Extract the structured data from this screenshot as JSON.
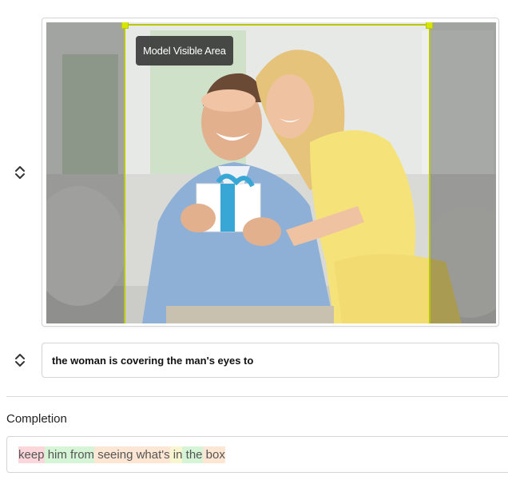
{
  "image_block": {
    "area_label": "Model Visible Area",
    "frame_color": "#b8c700",
    "icons": {
      "reorder": "chevron-up-down-icon"
    }
  },
  "prompt_block": {
    "text": "the woman is covering the man's eyes to",
    "icons": {
      "reorder": "chevron-up-down-icon"
    }
  },
  "completion": {
    "title": "Completion",
    "tokens": [
      {
        "text": "keep",
        "color": "#fbd7dc"
      },
      {
        "text": " him",
        "color": "#d6f5d6"
      },
      {
        "text": " from",
        "color": "#d6f5d6"
      },
      {
        "text": " seeing",
        "color": "#fde7d4"
      },
      {
        "text": " what's",
        "color": "#fde7d4"
      },
      {
        "text": " in",
        "color": "#f7f6d0"
      },
      {
        "text": " the",
        "color": "#d6f5d6"
      },
      {
        "text": " box",
        "color": "#fde7d4"
      }
    ]
  }
}
